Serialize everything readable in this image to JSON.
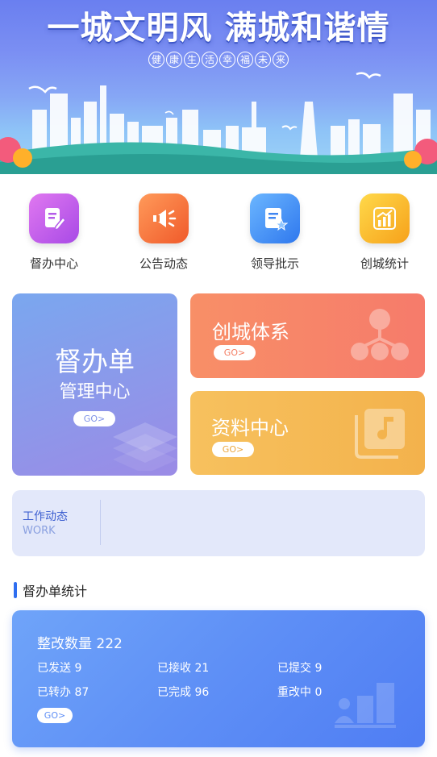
{
  "banner": {
    "title": "一城文明风 满城和谐情",
    "subtitle_chars": [
      "健",
      "康",
      "生",
      "活",
      "幸",
      "福",
      "未",
      "来"
    ]
  },
  "quick_menu": [
    {
      "label": "督办中心",
      "icon": "edit-document-icon",
      "color_from": "#e078f0",
      "color_to": "#a84ae6"
    },
    {
      "label": "公告动态",
      "icon": "megaphone-icon",
      "color_from": "#ff9a5a",
      "color_to": "#f05a2a"
    },
    {
      "label": "领导批示",
      "icon": "document-star-icon",
      "color_from": "#6bb6ff",
      "color_to": "#2f78ee"
    },
    {
      "label": "创城统计",
      "icon": "bar-chart-icon",
      "color_from": "#ffd94a",
      "color_to": "#f6a11a"
    }
  ],
  "cards": {
    "supervision": {
      "title": "督办单",
      "subtitle": "管理中心",
      "go": "GO>"
    },
    "system": {
      "title": "创城体系",
      "go": "GO>"
    },
    "data_center": {
      "title": "资料中心",
      "go": "GO>"
    }
  },
  "work": {
    "title": "工作动态",
    "subtitle": "WORK"
  },
  "section": {
    "title": "督办单统计"
  },
  "stats": {
    "total": "整改数量 222",
    "items": [
      "已发送 9",
      "已接收 21",
      "已提交 9",
      "已转办 87",
      "已完成 96",
      "重改中 0"
    ],
    "go": "GO>"
  }
}
